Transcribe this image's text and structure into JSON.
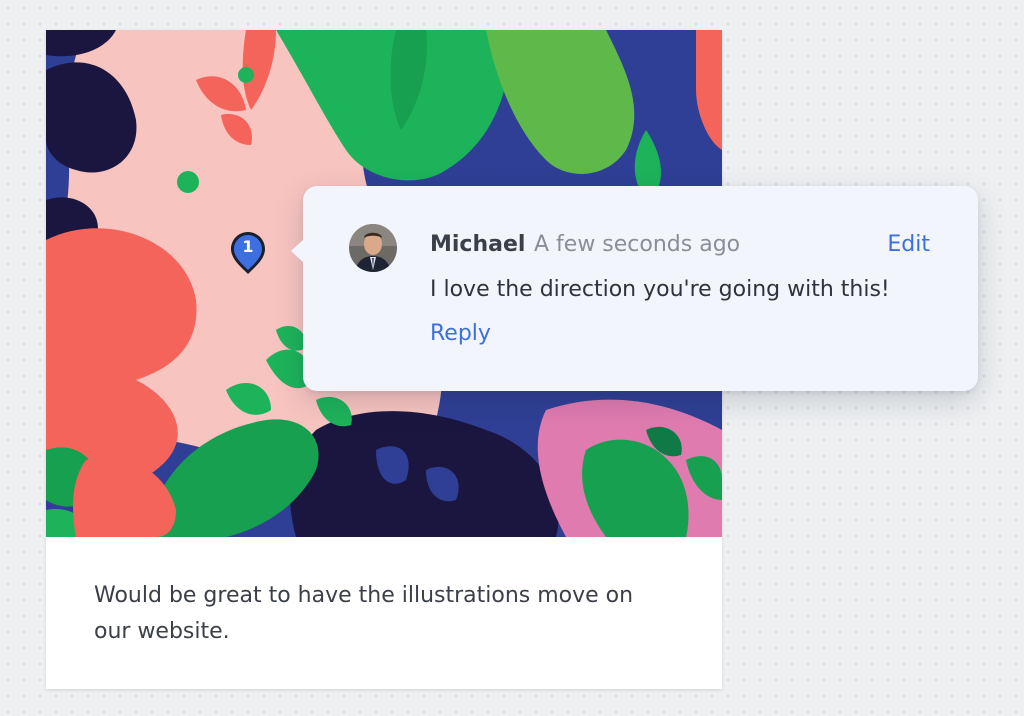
{
  "card": {
    "text": "Would be great to have the illustrations move on our website."
  },
  "pin": {
    "number": "1",
    "color": "#3d6fe0"
  },
  "comment": {
    "author": "Michael",
    "timestamp": "A few seconds ago",
    "edit_label": "Edit",
    "body": "I love the direction you're going with this!",
    "reply_label": "Reply"
  },
  "colors": {
    "accent": "#3d6fe0",
    "illustration_navy": "#2f3f95",
    "illustration_pink": "#f8c4c0",
    "illustration_coral": "#f5645a",
    "illustration_green": "#1db35a",
    "illustration_dark": "#1b1640"
  }
}
